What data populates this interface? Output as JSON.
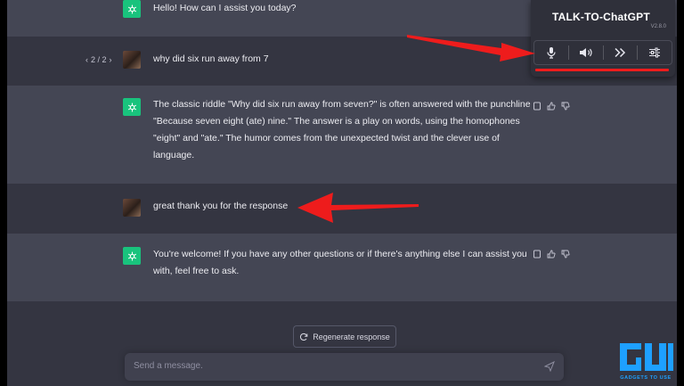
{
  "conversation": {
    "messages": [
      {
        "role": "assistant",
        "text": "Hello! How can I assist you today?"
      },
      {
        "role": "user",
        "text": "why did six run away from 7",
        "pager": "2 / 2"
      },
      {
        "role": "assistant",
        "lines": [
          "The classic riddle \"Why did six run away from seven?\" is often answered with the punchline",
          "\"Because seven eight (ate) nine.\" The answer is a play on words, using the homophones",
          "\"eight\" and \"ate.\" The humor comes from the unexpected twist and the clever use of",
          "language."
        ]
      },
      {
        "role": "user",
        "text": "great thank you for the response"
      },
      {
        "role": "assistant",
        "lines": [
          "You're welcome! If you have any other questions or if there's anything else I can assist you",
          "with, feel free to ask."
        ]
      }
    ]
  },
  "extension": {
    "title": "TALK-TO-ChatGPT",
    "version": "V2.8.0",
    "buttons": [
      "microphone-icon",
      "speaker-icon",
      "skip-icon",
      "settings-sliders-icon"
    ]
  },
  "composer": {
    "regenerate_label": "Regenerate response",
    "placeholder": "Send a message."
  },
  "watermark": {
    "logo_text": "GADGETS TO USE"
  },
  "colors": {
    "background": "#343541",
    "assistant_row": "#444654",
    "gpt_green": "#19c37d",
    "annotation_red": "#ee1c1c",
    "watermark_blue": "#1ea0ff"
  }
}
